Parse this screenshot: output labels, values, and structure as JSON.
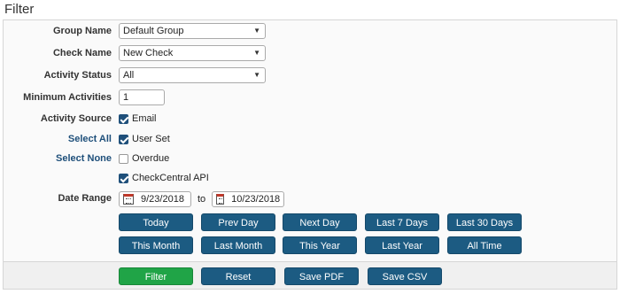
{
  "page": {
    "title": "Filter"
  },
  "fields": {
    "group_name": {
      "label": "Group Name",
      "value": "Default Group"
    },
    "check_name": {
      "label": "Check Name",
      "value": "New Check"
    },
    "activity_status": {
      "label": "Activity Status",
      "value": "All"
    },
    "minimum_activities": {
      "label": "Minimum Activities",
      "value": "1"
    },
    "activity_source": {
      "label": "Activity Source"
    },
    "select_all": "Select All",
    "select_none": "Select None",
    "sources": [
      {
        "label": "Email",
        "checked": true
      },
      {
        "label": "User Set",
        "checked": true
      },
      {
        "label": "Overdue",
        "checked": false
      },
      {
        "label": "CheckCentral API",
        "checked": true
      }
    ],
    "date_range": {
      "label": "Date Range",
      "from": "9/23/2018",
      "to_label": "to",
      "to": "10/23/2018"
    }
  },
  "quick_ranges": [
    "Today",
    "Prev Day",
    "Next Day",
    "Last 7 Days",
    "Last 30 Days",
    "This Month",
    "Last Month",
    "This Year",
    "Last Year",
    "All Time"
  ],
  "actions": {
    "filter": "Filter",
    "reset": "Reset",
    "save_pdf": "Save PDF",
    "save_csv": "Save CSV"
  },
  "colors": {
    "primary_button": "#1c5b82",
    "filter_button": "#20a447",
    "link": "#1e4f7a"
  }
}
